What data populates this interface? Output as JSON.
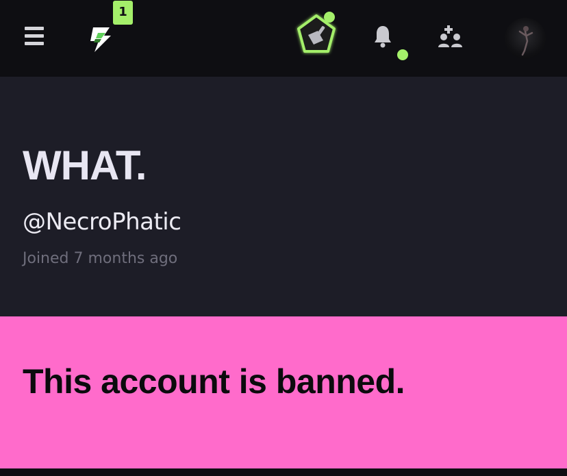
{
  "topbar": {
    "menu_icon": "hamburger-menu-icon",
    "bolt_icon": "lightning-bolt-icon",
    "bolt_count": "1",
    "pentagon_icon": "pentagon-badge-icon",
    "bell_icon": "bell-icon",
    "add_people_icon": "add-people-icon",
    "accent_color": "#a4ef6a"
  },
  "profile": {
    "display_name": "WHAT.",
    "handle": "@NecroPhatic",
    "joined": "Joined 7 months ago"
  },
  "banner": {
    "text": "This account is banned.",
    "color": "#ff6bcb"
  }
}
